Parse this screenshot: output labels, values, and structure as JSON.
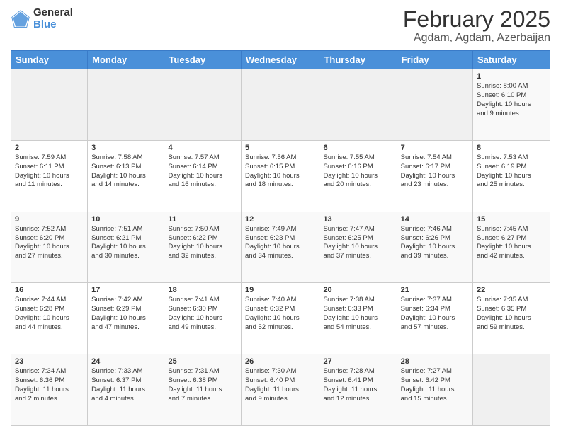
{
  "logo": {
    "general": "General",
    "blue": "Blue"
  },
  "header": {
    "title": "February 2025",
    "subtitle": "Agdam, Agdam, Azerbaijan"
  },
  "weekdays": [
    "Sunday",
    "Monday",
    "Tuesday",
    "Wednesday",
    "Thursday",
    "Friday",
    "Saturday"
  ],
  "weeks": [
    [
      {
        "day": "",
        "info": ""
      },
      {
        "day": "",
        "info": ""
      },
      {
        "day": "",
        "info": ""
      },
      {
        "day": "",
        "info": ""
      },
      {
        "day": "",
        "info": ""
      },
      {
        "day": "",
        "info": ""
      },
      {
        "day": "1",
        "info": "Sunrise: 8:00 AM\nSunset: 6:10 PM\nDaylight: 10 hours\nand 9 minutes."
      }
    ],
    [
      {
        "day": "2",
        "info": "Sunrise: 7:59 AM\nSunset: 6:11 PM\nDaylight: 10 hours\nand 11 minutes."
      },
      {
        "day": "3",
        "info": "Sunrise: 7:58 AM\nSunset: 6:13 PM\nDaylight: 10 hours\nand 14 minutes."
      },
      {
        "day": "4",
        "info": "Sunrise: 7:57 AM\nSunset: 6:14 PM\nDaylight: 10 hours\nand 16 minutes."
      },
      {
        "day": "5",
        "info": "Sunrise: 7:56 AM\nSunset: 6:15 PM\nDaylight: 10 hours\nand 18 minutes."
      },
      {
        "day": "6",
        "info": "Sunrise: 7:55 AM\nSunset: 6:16 PM\nDaylight: 10 hours\nand 20 minutes."
      },
      {
        "day": "7",
        "info": "Sunrise: 7:54 AM\nSunset: 6:17 PM\nDaylight: 10 hours\nand 23 minutes."
      },
      {
        "day": "8",
        "info": "Sunrise: 7:53 AM\nSunset: 6:19 PM\nDaylight: 10 hours\nand 25 minutes."
      }
    ],
    [
      {
        "day": "9",
        "info": "Sunrise: 7:52 AM\nSunset: 6:20 PM\nDaylight: 10 hours\nand 27 minutes."
      },
      {
        "day": "10",
        "info": "Sunrise: 7:51 AM\nSunset: 6:21 PM\nDaylight: 10 hours\nand 30 minutes."
      },
      {
        "day": "11",
        "info": "Sunrise: 7:50 AM\nSunset: 6:22 PM\nDaylight: 10 hours\nand 32 minutes."
      },
      {
        "day": "12",
        "info": "Sunrise: 7:49 AM\nSunset: 6:23 PM\nDaylight: 10 hours\nand 34 minutes."
      },
      {
        "day": "13",
        "info": "Sunrise: 7:47 AM\nSunset: 6:25 PM\nDaylight: 10 hours\nand 37 minutes."
      },
      {
        "day": "14",
        "info": "Sunrise: 7:46 AM\nSunset: 6:26 PM\nDaylight: 10 hours\nand 39 minutes."
      },
      {
        "day": "15",
        "info": "Sunrise: 7:45 AM\nSunset: 6:27 PM\nDaylight: 10 hours\nand 42 minutes."
      }
    ],
    [
      {
        "day": "16",
        "info": "Sunrise: 7:44 AM\nSunset: 6:28 PM\nDaylight: 10 hours\nand 44 minutes."
      },
      {
        "day": "17",
        "info": "Sunrise: 7:42 AM\nSunset: 6:29 PM\nDaylight: 10 hours\nand 47 minutes."
      },
      {
        "day": "18",
        "info": "Sunrise: 7:41 AM\nSunset: 6:30 PM\nDaylight: 10 hours\nand 49 minutes."
      },
      {
        "day": "19",
        "info": "Sunrise: 7:40 AM\nSunset: 6:32 PM\nDaylight: 10 hours\nand 52 minutes."
      },
      {
        "day": "20",
        "info": "Sunrise: 7:38 AM\nSunset: 6:33 PM\nDaylight: 10 hours\nand 54 minutes."
      },
      {
        "day": "21",
        "info": "Sunrise: 7:37 AM\nSunset: 6:34 PM\nDaylight: 10 hours\nand 57 minutes."
      },
      {
        "day": "22",
        "info": "Sunrise: 7:35 AM\nSunset: 6:35 PM\nDaylight: 10 hours\nand 59 minutes."
      }
    ],
    [
      {
        "day": "23",
        "info": "Sunrise: 7:34 AM\nSunset: 6:36 PM\nDaylight: 11 hours\nand 2 minutes."
      },
      {
        "day": "24",
        "info": "Sunrise: 7:33 AM\nSunset: 6:37 PM\nDaylight: 11 hours\nand 4 minutes."
      },
      {
        "day": "25",
        "info": "Sunrise: 7:31 AM\nSunset: 6:38 PM\nDaylight: 11 hours\nand 7 minutes."
      },
      {
        "day": "26",
        "info": "Sunrise: 7:30 AM\nSunset: 6:40 PM\nDaylight: 11 hours\nand 9 minutes."
      },
      {
        "day": "27",
        "info": "Sunrise: 7:28 AM\nSunset: 6:41 PM\nDaylight: 11 hours\nand 12 minutes."
      },
      {
        "day": "28",
        "info": "Sunrise: 7:27 AM\nSunset: 6:42 PM\nDaylight: 11 hours\nand 15 minutes."
      },
      {
        "day": "",
        "info": ""
      }
    ]
  ]
}
